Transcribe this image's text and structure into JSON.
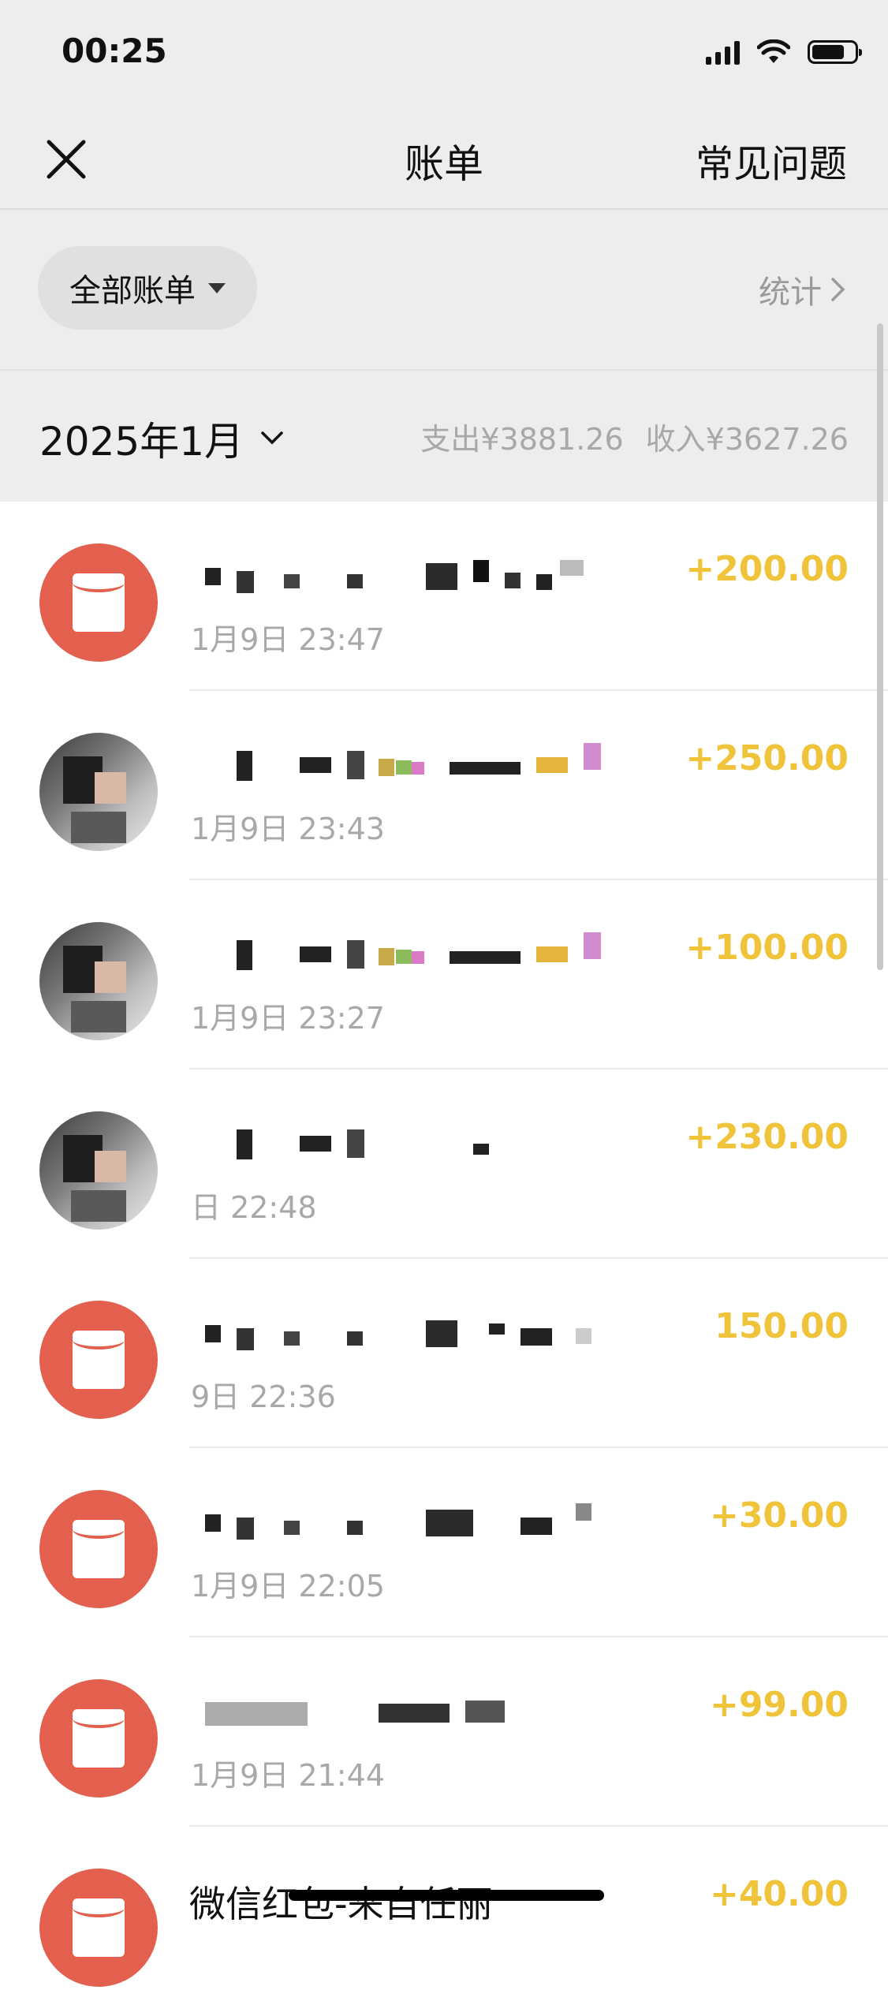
{
  "status_bar": {
    "time": "00:25"
  },
  "header": {
    "title": "账单",
    "faq_label": "常见问题"
  },
  "filter": {
    "label": "全部账单",
    "stats_label": "统计"
  },
  "month": {
    "label": "2025年1月",
    "expense": "支出¥3881.26",
    "income": "收入¥3627.26"
  },
  "transactions": [
    {
      "title": "",
      "time": "1月9日 23:47",
      "amount": "+200.00",
      "avatar": "red-packet-icon"
    },
    {
      "title": "",
      "time": "1月9日 23:43",
      "amount": "+250.00",
      "avatar": "user-avatar"
    },
    {
      "title": "",
      "time": "1月9日 23:27",
      "amount": "+100.00",
      "avatar": "user-avatar"
    },
    {
      "title": "",
      "time": "日 22:48",
      "amount": "+230.00",
      "avatar": "user-avatar"
    },
    {
      "title": "",
      "time": "9日 22:36",
      "amount": "150.00",
      "avatar": "red-packet-icon"
    },
    {
      "title": "",
      "time": "1月9日 22:05",
      "amount": "+30.00",
      "avatar": "red-packet-icon"
    },
    {
      "title": "",
      "time": "1月9日 21:44",
      "amount": "+99.00",
      "avatar": "red-packet-icon"
    },
    {
      "title": "微信红包-来自任丽",
      "time": "",
      "amount": "+40.00",
      "avatar": "red-packet-icon"
    }
  ],
  "colors": {
    "amount": "#f0c43a",
    "red_packet": "#e4604e",
    "background_grey": "#ededed"
  }
}
